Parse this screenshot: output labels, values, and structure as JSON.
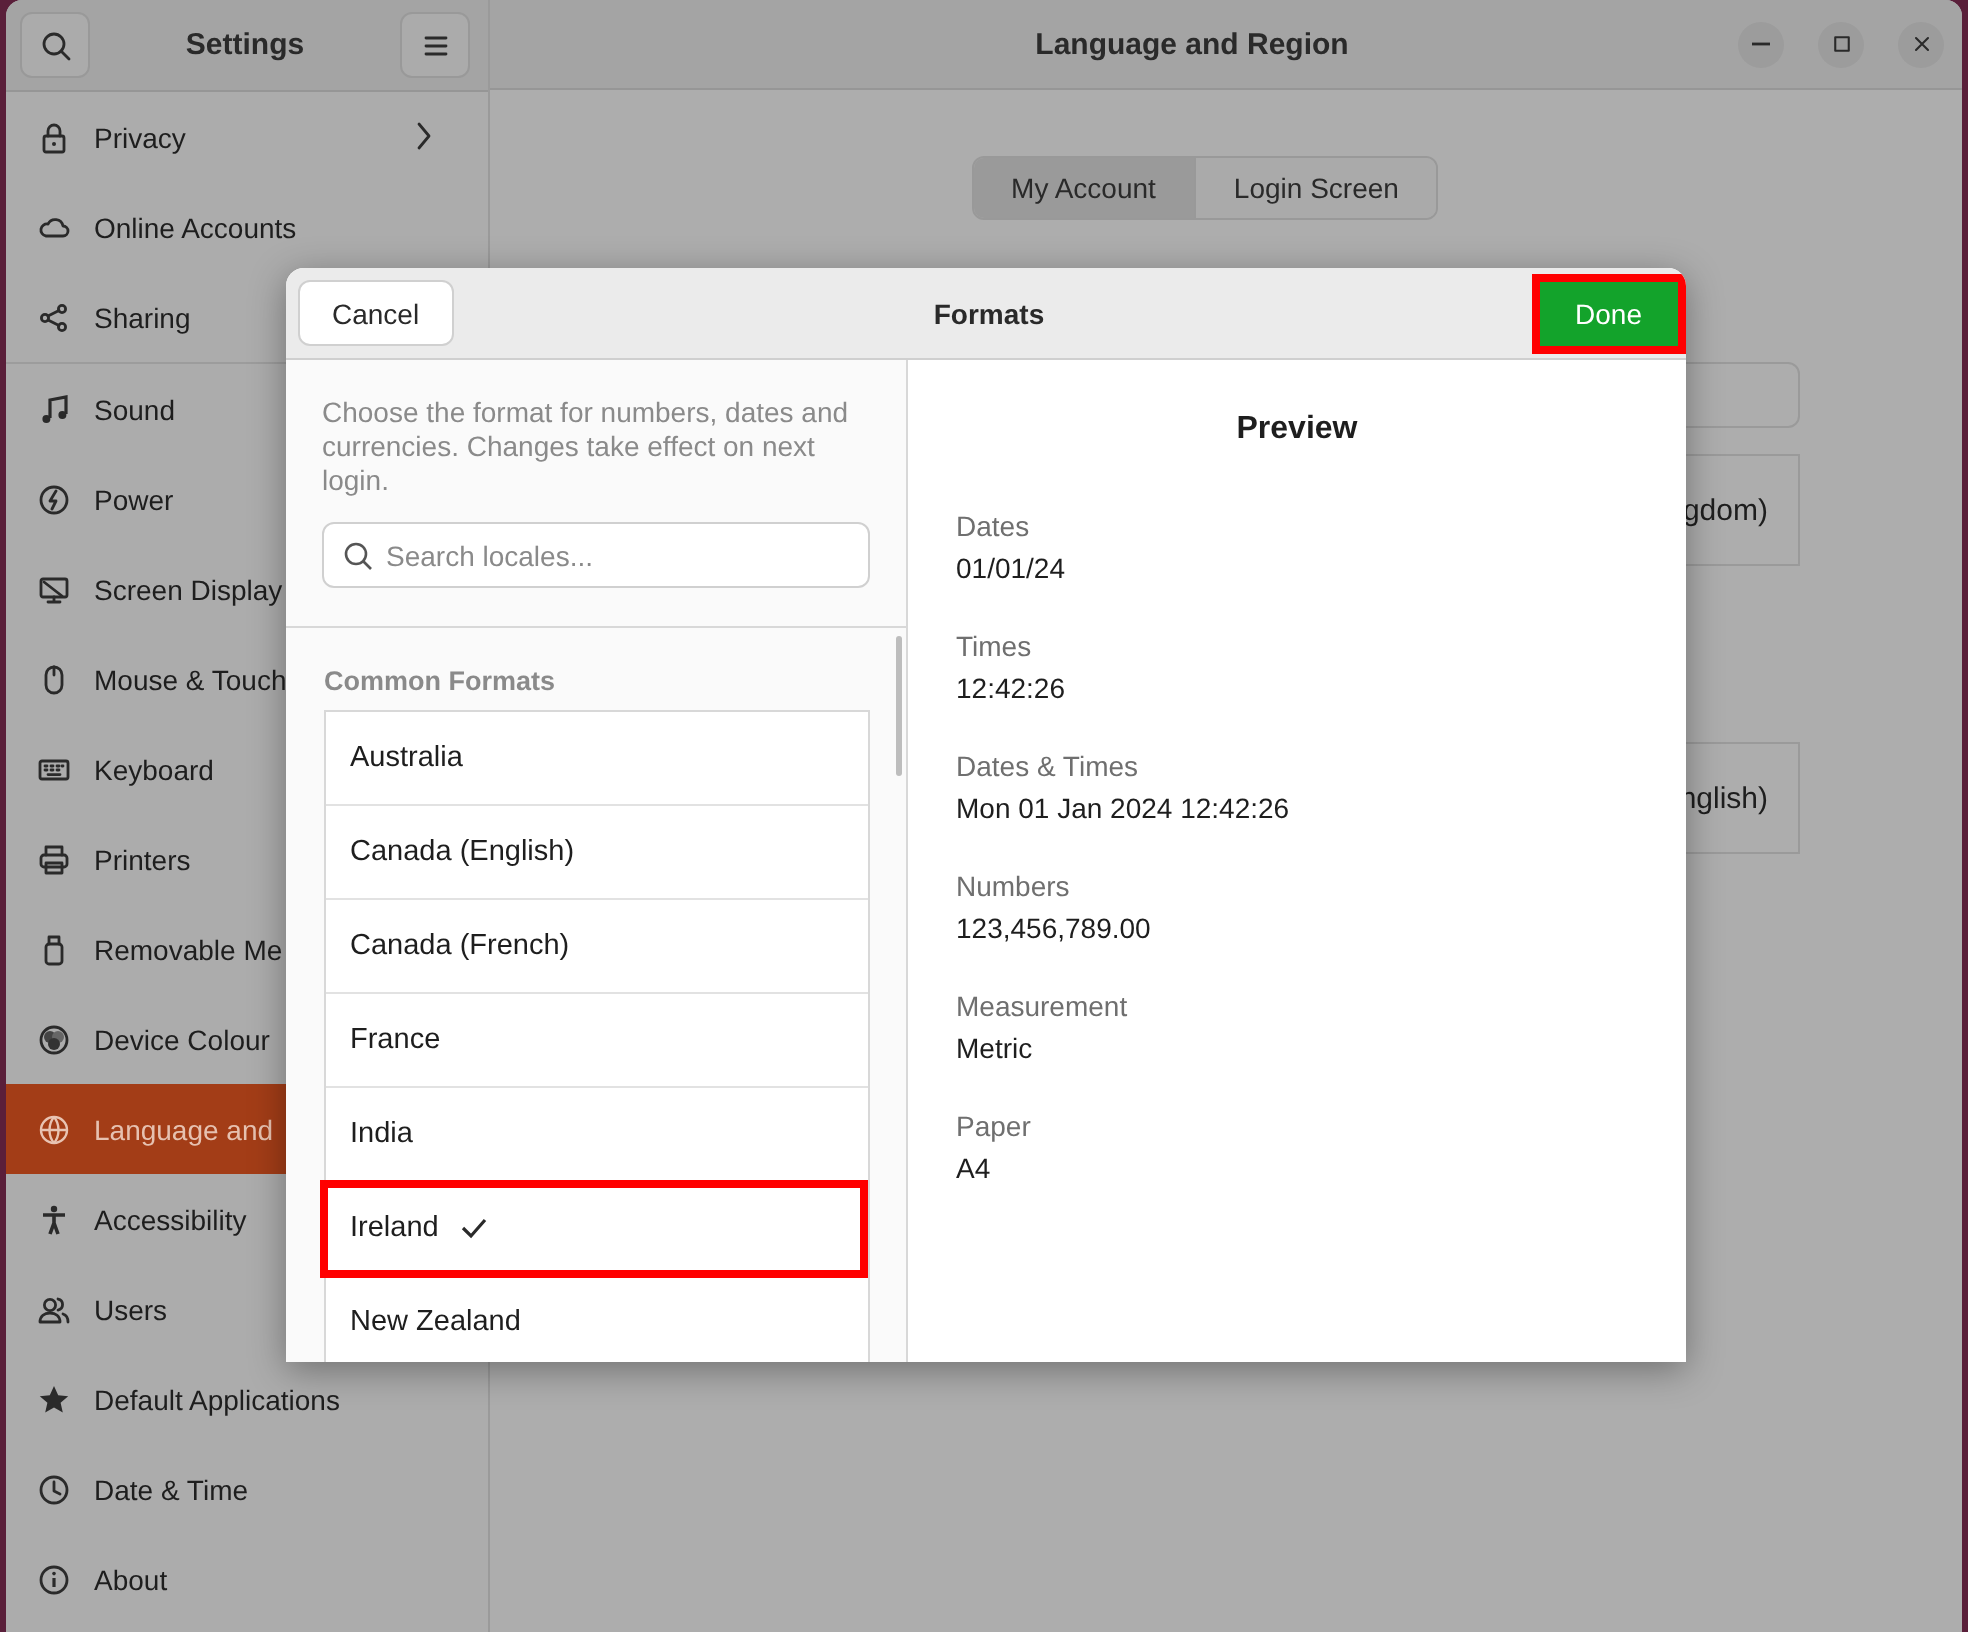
{
  "window": {
    "title": "Settings",
    "page_title": "Language and Region"
  },
  "sidebar": {
    "groups": [
      {
        "items": [
          {
            "label": "Privacy",
            "selected": false,
            "submenu": true
          },
          {
            "label": "Online Accounts",
            "selected": false,
            "submenu": false
          },
          {
            "label": "Sharing",
            "selected": false,
            "submenu": false
          }
        ]
      },
      {
        "items": [
          {
            "label": "Sound",
            "selected": false,
            "submenu": false
          },
          {
            "label": "Power",
            "selected": false,
            "submenu": false
          },
          {
            "label": "Screen Display",
            "selected": false,
            "submenu": false
          },
          {
            "label": "Mouse & Touch",
            "selected": false,
            "submenu": false
          },
          {
            "label": "Keyboard",
            "selected": false,
            "submenu": false
          },
          {
            "label": "Printers",
            "selected": false,
            "submenu": false
          },
          {
            "label": "Removable Me",
            "selected": false,
            "submenu": false
          },
          {
            "label": "Device Colour",
            "selected": false,
            "submenu": false
          },
          {
            "label": "Language and",
            "selected": true,
            "submenu": false
          },
          {
            "label": "Accessibility",
            "selected": false,
            "submenu": false
          },
          {
            "label": "Users",
            "selected": false,
            "submenu": false
          },
          {
            "label": "Default Applications",
            "selected": false,
            "submenu": false
          },
          {
            "label": "Date & Time",
            "selected": false,
            "submenu": false
          },
          {
            "label": "About",
            "selected": false,
            "submenu": false
          }
        ]
      }
    ]
  },
  "content": {
    "tabs": [
      {
        "label": "My Account",
        "selected": true
      },
      {
        "label": "Login Screen",
        "selected": false
      }
    ],
    "rows": [
      {
        "kind": "field"
      },
      {
        "kind": "row",
        "text": "gdom)"
      },
      {
        "kind": "row",
        "text": "nglish)"
      }
    ]
  },
  "dialog": {
    "title": "Formats",
    "cancel_button": "Cancel",
    "done_button": {
      "label": "Done",
      "highlighted": true
    },
    "description": "Choose the format for numbers, dates and currencies. Changes take effect on next login.",
    "search": {
      "placeholder": "Search locales..."
    },
    "section_heading": "Common Formats",
    "locales": [
      {
        "name": "Australia",
        "selected": false,
        "highlighted": false
      },
      {
        "name": "Canada (English)",
        "selected": false,
        "highlighted": false
      },
      {
        "name": "Canada (French)",
        "selected": false,
        "highlighted": false
      },
      {
        "name": "France",
        "selected": false,
        "highlighted": false
      },
      {
        "name": "India",
        "selected": false,
        "highlighted": false
      },
      {
        "name": "Ireland",
        "selected": true,
        "highlighted": true
      },
      {
        "name": "New Zealand",
        "selected": false,
        "highlighted": false
      }
    ],
    "preview": {
      "title": "Preview",
      "fields": [
        {
          "label": "Dates",
          "value": "01/01/24"
        },
        {
          "label": "Times",
          "value": "12:42:26"
        },
        {
          "label": "Dates & Times",
          "value": "Mon 01 Jan 2024 12:42:26"
        },
        {
          "label": "Numbers",
          "value": "123,456,789.00"
        },
        {
          "label": "Measurement",
          "value": "Metric"
        },
        {
          "label": "Paper",
          "value": "A4"
        }
      ]
    }
  }
}
